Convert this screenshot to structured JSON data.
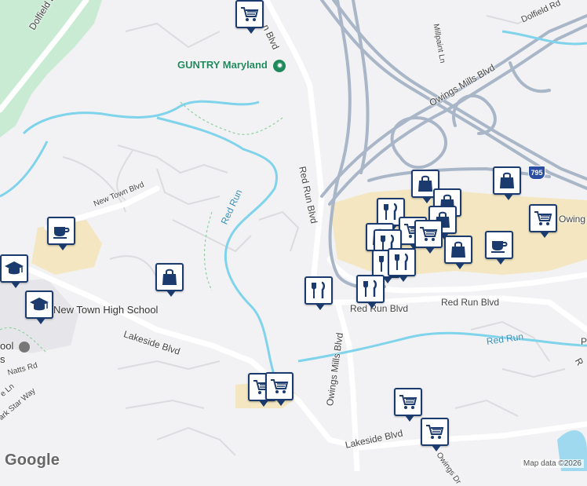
{
  "roads": {
    "dolfield_blvd_w": "Dolfield Blvd",
    "dolfield_rd": "Dolfield Rd",
    "millpaint_ln": "Millpaint Ln",
    "red_run_blvd_n": "Red Run Blvd",
    "red_run_blvd_top": "n Blvd",
    "owings_mills_blvd_ne": "Owings Mills Blvd",
    "new_town_blvd": "New Town Blvd",
    "lakeside_blvd_w": "Lakeside Blvd",
    "lakeside_blvd_s": "Lakeside Blvd",
    "red_run_blvd_s": "Red Run Blvd",
    "red_run_blvd_s2": "Red Run Blvd",
    "owings_mills_blvd_s": "Owings Mills Blvd",
    "owings_right": "Owing",
    "natts_rd": "Natts Rd",
    "ark_star_way": "ark Star Way",
    "owings_dr": "Owings Dr",
    "lane_sw": "e Ln",
    "right_edge_r": "R",
    "right_edge_p": "P",
    "interstate": "795"
  },
  "water": {
    "red_run_w": "Red Run",
    "red_run_e": "Red Run"
  },
  "poi": {
    "guntry": "GUNTRY Maryland",
    "new_town_high": "New Town High School",
    "school_left": "ool",
    "school_left2": "s"
  },
  "attribution": "Map data ©2026",
  "logo": "Google",
  "colors": {
    "pin_border": "#1b3a6e",
    "water": "#7fd3ea",
    "park": "#c9ebd3",
    "mall": "#f3e6c0",
    "highway": "#a9b6c8"
  },
  "pins": [
    {
      "icon": "grocery"
    },
    {
      "icon": "cafe"
    },
    {
      "icon": "school"
    },
    {
      "icon": "school"
    },
    {
      "icon": "shopping"
    },
    {
      "icon": "shopping"
    },
    {
      "icon": "shopping"
    },
    {
      "icon": "shopping"
    },
    {
      "icon": "restaurant"
    },
    {
      "icon": "grocery"
    },
    {
      "icon": "shopping"
    },
    {
      "icon": "grocery"
    },
    {
      "icon": "shopping"
    },
    {
      "icon": "restaurant"
    },
    {
      "icon": "grocery"
    },
    {
      "icon": "cafe"
    },
    {
      "icon": "shopping"
    },
    {
      "icon": "restaurant"
    },
    {
      "icon": "restaurant"
    },
    {
      "icon": "restaurant"
    },
    {
      "icon": "restaurant"
    },
    {
      "icon": "grocery"
    },
    {
      "icon": "grocery"
    },
    {
      "icon": "grocery"
    },
    {
      "icon": "grocery"
    }
  ]
}
